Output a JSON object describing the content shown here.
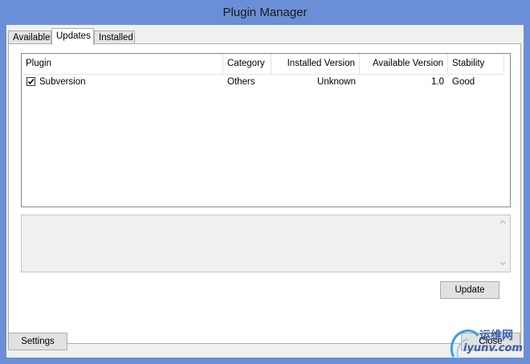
{
  "window": {
    "title": "Plugin Manager"
  },
  "tabs": [
    {
      "label": "Available"
    },
    {
      "label": "Updates"
    },
    {
      "label": "Installed"
    }
  ],
  "table": {
    "columns": [
      "Plugin",
      "Category",
      "Installed Version",
      "Available Version",
      "Stability"
    ],
    "rows": [
      {
        "checked": true,
        "plugin": "Subversion",
        "category": "Others",
        "installed_version": "Unknown",
        "available_version": "1.0",
        "stability": "Good"
      }
    ]
  },
  "description": {
    "text": ""
  },
  "buttons": {
    "update": "Update",
    "settings": "Settings",
    "close": "Close"
  },
  "watermark": {
    "line1": "运维网",
    "line2": "iyunv.com"
  },
  "colors": {
    "titlebar": "#6b8fd6",
    "panel": "#f0f0f0",
    "border": "#adadad"
  }
}
